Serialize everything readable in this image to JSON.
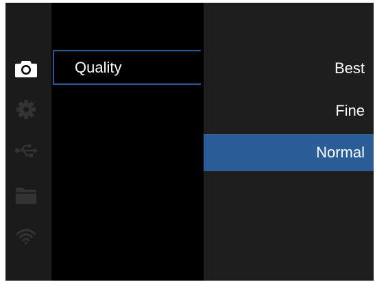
{
  "sidebar": {
    "icons": [
      {
        "name": "camera-icon",
        "active": true
      },
      {
        "name": "gear-icon",
        "active": false
      },
      {
        "name": "usb-icon",
        "active": false
      },
      {
        "name": "folder-icon",
        "active": false
      },
      {
        "name": "wifi-icon",
        "active": false
      }
    ]
  },
  "menu": {
    "items": [
      {
        "label": "Quality",
        "highlighted": true
      }
    ]
  },
  "options": {
    "items": [
      {
        "label": "Best",
        "selected": false
      },
      {
        "label": "Fine",
        "selected": false
      },
      {
        "label": "Normal",
        "selected": true
      }
    ]
  },
  "colors": {
    "background": "#000000",
    "sidebar": "#1b1b1b",
    "options_panel": "#1e1e1e",
    "selection": "#2b5d99",
    "menu_border": "#2a5a9a",
    "icon_active": "#ffffff",
    "icon_inactive": "#333333",
    "text": "#ffffff"
  }
}
